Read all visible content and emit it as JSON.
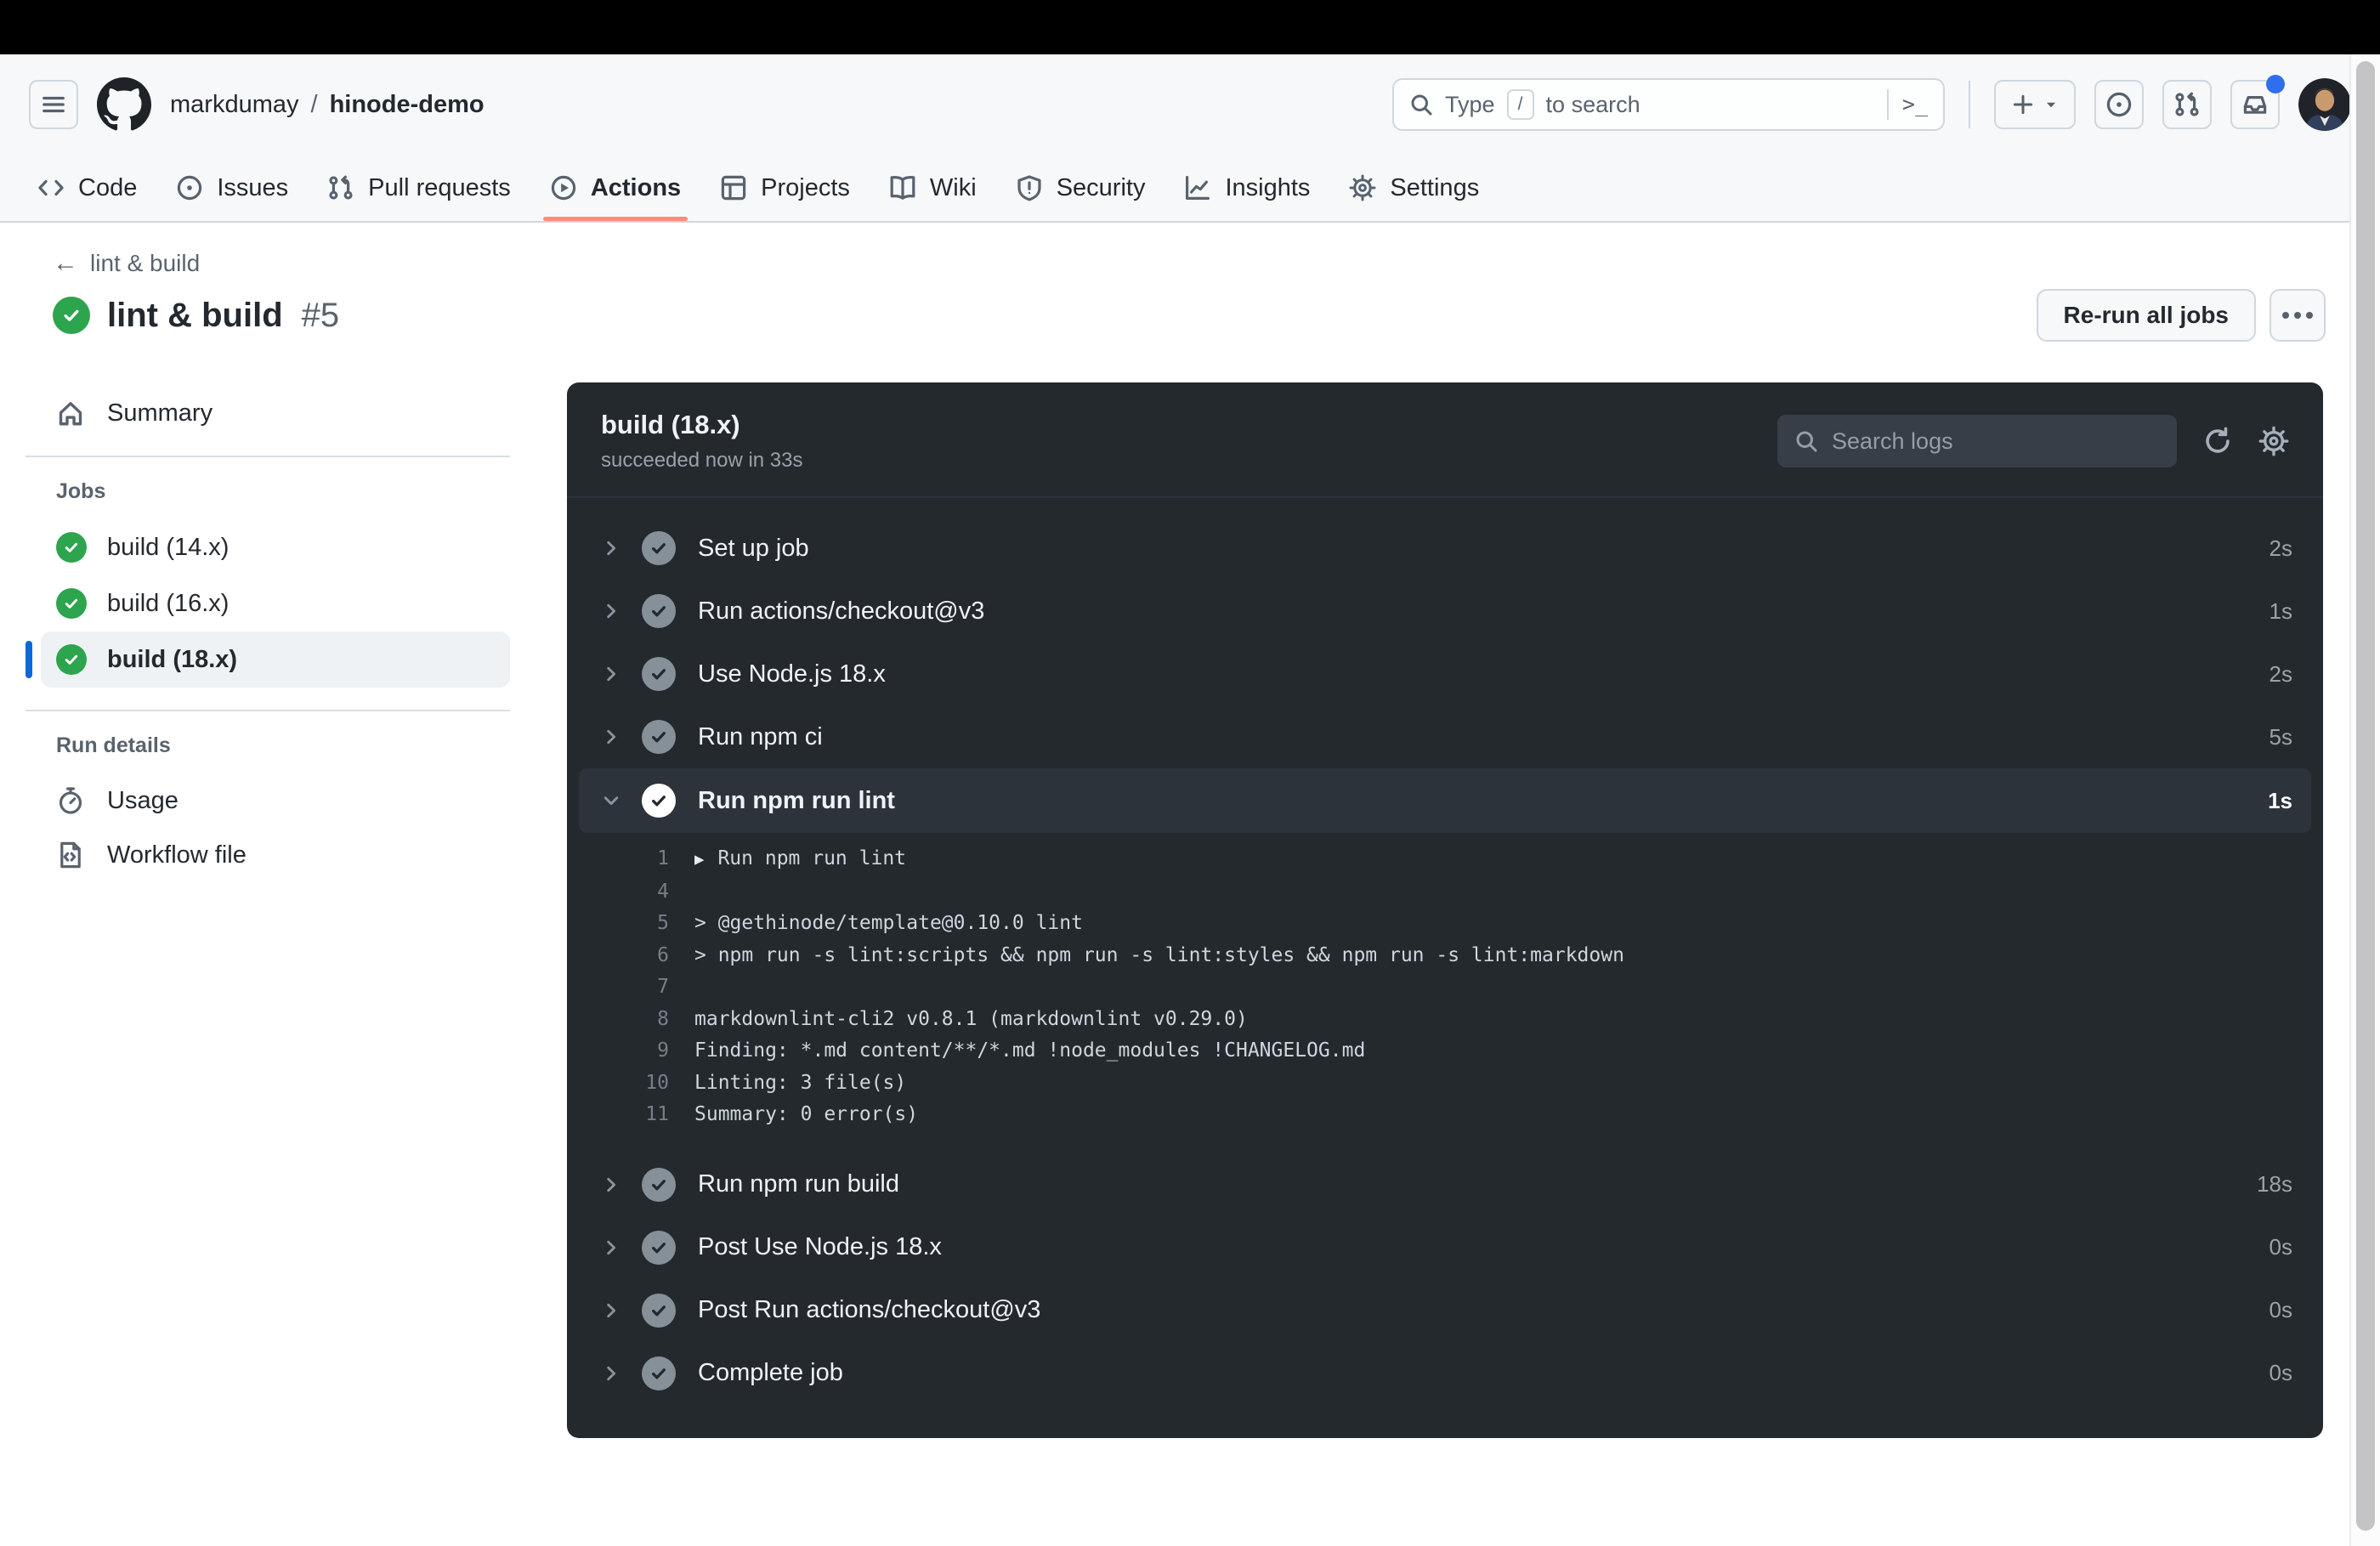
{
  "colors": {
    "success_green": "#2da44e",
    "actions_tab_underline": "#fd8c73",
    "selected_job_accent": "#0969da",
    "notification_dot_blue": "#2f6feb",
    "panel_background": "#24292e"
  },
  "global_header": {
    "breadcrumb": {
      "owner": "markdumay",
      "separator": "/",
      "repo": "hinode-demo"
    },
    "search": {
      "prefix": "Type",
      "slash_key": "/",
      "suffix": "to search"
    }
  },
  "repo_tabs": [
    {
      "label": "Code",
      "icon": "code-icon",
      "active": false
    },
    {
      "label": "Issues",
      "icon": "issue-opened-icon",
      "active": false
    },
    {
      "label": "Pull requests",
      "icon": "git-pull-request-icon",
      "active": false
    },
    {
      "label": "Actions",
      "icon": "play-circle-icon",
      "active": true
    },
    {
      "label": "Projects",
      "icon": "table-icon",
      "active": false
    },
    {
      "label": "Wiki",
      "icon": "book-icon",
      "active": false
    },
    {
      "label": "Security",
      "icon": "shield-icon",
      "active": false
    },
    {
      "label": "Insights",
      "icon": "graph-icon",
      "active": false
    },
    {
      "label": "Settings",
      "icon": "gear-icon",
      "active": false
    }
  ],
  "run": {
    "back_label": "lint & build",
    "title": "lint & build",
    "number": "#5",
    "rerun_label": "Re-run all jobs"
  },
  "sidebar": {
    "summary_label": "Summary",
    "jobs_heading": "Jobs",
    "jobs": [
      {
        "label": "build (14.x)",
        "selected": false
      },
      {
        "label": "build (16.x)",
        "selected": false
      },
      {
        "label": "build (18.x)",
        "selected": true
      }
    ],
    "run_details_heading": "Run details",
    "usage_label": "Usage",
    "workflow_file_label": "Workflow file"
  },
  "log_panel": {
    "job_title": "build (18.x)",
    "job_status": "succeeded now in 33s",
    "search_placeholder": "Search logs",
    "steps": [
      {
        "name": "Set up job",
        "duration": "2s"
      },
      {
        "name": "Run actions/checkout@v3",
        "duration": "1s"
      },
      {
        "name": "Use Node.js 18.x",
        "duration": "2s"
      },
      {
        "name": "Run npm ci",
        "duration": "5s"
      },
      {
        "name": "Run npm run lint",
        "duration": "1s",
        "expanded": true,
        "log_lines": [
          {
            "num": "1",
            "text": "Run npm run lint",
            "group": true
          },
          {
            "num": "4",
            "text": ""
          },
          {
            "num": "5",
            "text": "> @gethinode/template@0.10.0 lint"
          },
          {
            "num": "6",
            "text": "> npm run -s lint:scripts && npm run -s lint:styles && npm run -s lint:markdown"
          },
          {
            "num": "7",
            "text": ""
          },
          {
            "num": "8",
            "text": "markdownlint-cli2 v0.8.1 (markdownlint v0.29.0)"
          },
          {
            "num": "9",
            "text": "Finding: *.md content/**/*.md !node_modules !CHANGELOG.md"
          },
          {
            "num": "10",
            "text": "Linting: 3 file(s)"
          },
          {
            "num": "11",
            "text": "Summary: 0 error(s)"
          }
        ]
      },
      {
        "name": "Run npm run build",
        "duration": "18s"
      },
      {
        "name": "Post Use Node.js 18.x",
        "duration": "0s"
      },
      {
        "name": "Post Run actions/checkout@v3",
        "duration": "0s"
      },
      {
        "name": "Complete job",
        "duration": "0s"
      }
    ]
  }
}
